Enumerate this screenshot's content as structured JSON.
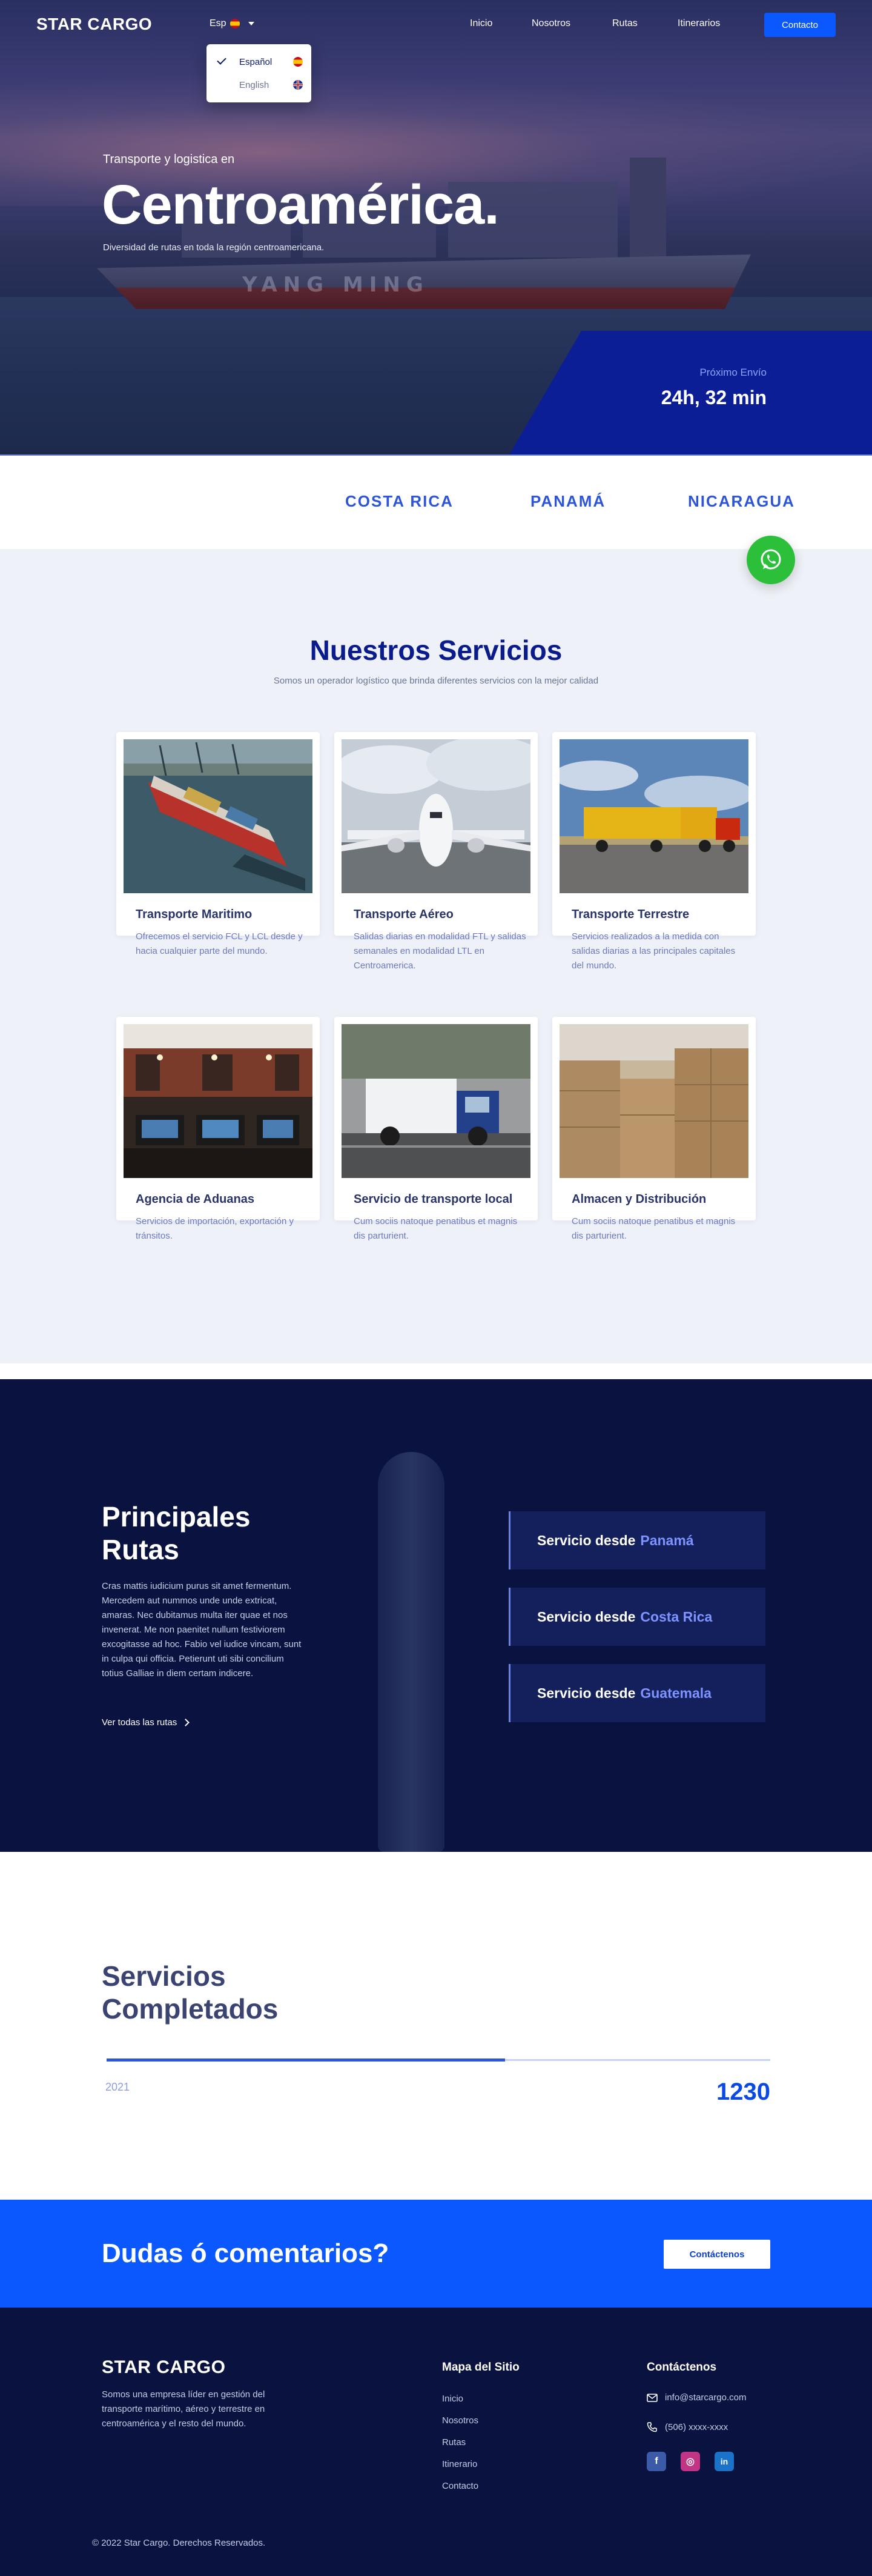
{
  "header": {
    "logo": "STAR CARGO",
    "language": {
      "current": "Esp",
      "options": [
        {
          "label": "Español",
          "selected": true,
          "flag": "spain-flag-icon"
        },
        {
          "label": "English",
          "selected": false,
          "flag": "uk-flag-icon"
        }
      ]
    },
    "nav": [
      "Inicio",
      "Nosotros",
      "Rutas",
      "Itinerarios"
    ],
    "contact_label": "Contacto"
  },
  "hero": {
    "eyebrow": "Transporte y logistica en",
    "title": "Centroamérica.",
    "subtitle": "Diversidad de rutas en toda la región centroamericana.",
    "ship_name": "YANG MING",
    "next_label": "Próximo Envío",
    "next_value": "24h, 32 min"
  },
  "countries": [
    "COSTA RICA",
    "PANAMÁ",
    "NICARAGUA"
  ],
  "services": {
    "title": "Nuestros Servicios",
    "subtitle": "Somos un operador logístico que brinda diferentes servicios con la mejor calidad",
    "cards": [
      {
        "title": "Transporte Maritimo",
        "desc": "Ofrecemos el servicio FCL y LCL desde y hacia cualquier parte del mundo."
      },
      {
        "title": "Transporte Aéreo",
        "desc": "Salidas diarias en modalidad FTL y salidas semanales en modalidad LTL en Centroamerica."
      },
      {
        "title": "Transporte Terrestre",
        "desc": "Servicios realizados a la medida con salidas diarias a las principales capitales del mundo."
      },
      {
        "title": "Agencia de Aduanas",
        "desc": "Servicios de importación, exportación y tránsitos."
      },
      {
        "title": "Servicio de transporte local",
        "desc": "Cum sociis natoque penatibus et magnis dis parturient."
      },
      {
        "title": "Almacen y Distribución",
        "desc": "Cum sociis natoque penatibus et magnis dis parturient."
      }
    ]
  },
  "routes": {
    "title": "Principales Rutas",
    "text": "Cras mattis iudicium purus sit amet fermentum. Mercedem aut nummos unde unde extricat, amaras. Nec dubitamus multa iter quae et nos invenerat. Me non paenitet nullum festiviorem excogitasse ad hoc. Fabio vel iudice vincam, sunt in culpa qui officia. Petierunt uti sibi concilium totius Galliae in diem certam indicere.",
    "link": "Ver todas las rutas",
    "prefix": "Servicio desde",
    "items": [
      "Panamá",
      "Costa Rica",
      "Guatemala"
    ]
  },
  "completed": {
    "title": "Servicios Completados",
    "year": "2021",
    "count": "1230",
    "progress": 0.6
  },
  "cta": {
    "title": "Dudas ó comentarios?",
    "button": "Contáctenos"
  },
  "footer": {
    "logo": "STAR CARGO",
    "about": "Somos una empresa líder en gestión del transporte marítimo, aéreo y terrestre en centroamérica y el resto del mundo.",
    "sitemap_title": "Mapa del Sitio",
    "sitemap": [
      "Inicio",
      "Nosotros",
      "Rutas",
      "Itinerario",
      "Contacto"
    ],
    "contact_title": "Contáctenos",
    "email": "info@starcargo.com",
    "phone": "(506) xxxx-xxxx",
    "socials": [
      {
        "label": "f",
        "icon": "facebook-icon",
        "color": "#3b5ba9"
      },
      {
        "label": "◎",
        "icon": "instagram-icon",
        "color": "#c13584"
      },
      {
        "label": "in",
        "icon": "linkedin-icon",
        "color": "#1a73c8"
      }
    ],
    "copyright": "© 2022 Star Cargo. Derechos Reservados."
  }
}
